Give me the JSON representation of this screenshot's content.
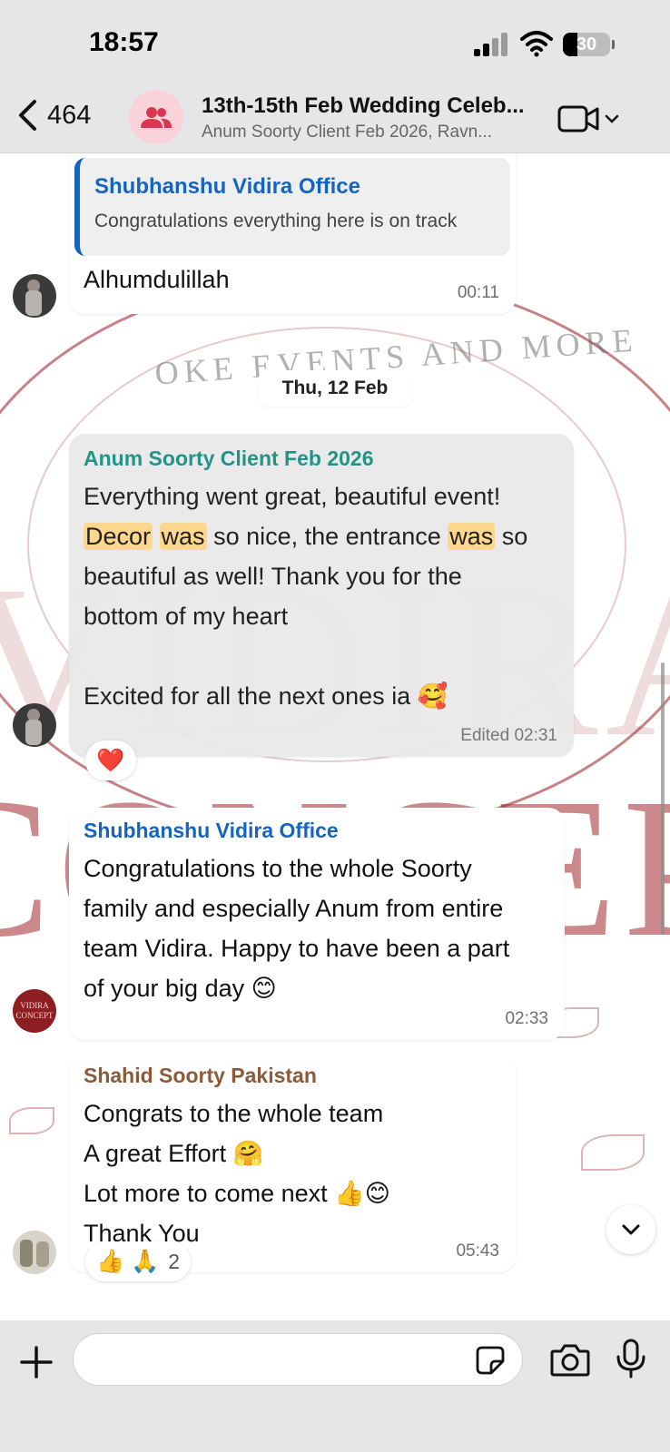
{
  "status_bar": {
    "time": "18:57",
    "battery": "30"
  },
  "header": {
    "back_count": "464",
    "title": "13th-15th Feb Wedding Celeb...",
    "subtitle": "Anum Soorty Client Feb 2026, Ravn..."
  },
  "messages": {
    "m1": {
      "quote_sender": "Shubhanshu Vidira Office",
      "quote_text": "Congratulations everything here is on track",
      "text": "Alhumdulillah",
      "time": "00:11"
    },
    "date_divider": "Thu, 12 Feb",
    "m2": {
      "sender": "Anum Soorty Client Feb 2026",
      "w_decor": "Decor",
      "w_was1": "was",
      "mid1": " so nice, the entrance ",
      "w_was2": "was",
      "tail1": " so",
      "line1": "Everything went great, beautiful event!",
      "line3": "beautiful as well! Thank you for the",
      "line4": "bottom of my heart",
      "line5": "Excited for all the next ones ia 🥰",
      "meta": "Edited 02:31",
      "reaction": "❤️"
    },
    "m3": {
      "sender": "Shubhanshu Vidira Office",
      "line1": "Congratulations to the whole Soorty",
      "line2": "family and especially Anum from entire",
      "line3": "team Vidira. Happy to have been a part",
      "line4": "of your big day 😊",
      "time": "02:33"
    },
    "m4": {
      "sender": "Shahid Soorty Pakistan",
      "line1": "Congrats to the whole team",
      "line2": "A great Effort 🤗",
      "line3": "Lot more to come next 👍😊",
      "line4": "Thank You",
      "time": "05:43",
      "reaction_emojis": "👍 🙏",
      "reaction_count": "2"
    }
  },
  "wallpaper": {
    "brand_text": "VIDIRA CONCEPT"
  },
  "colors": {
    "accent_blue": "#1565c0",
    "sender_teal": "#128c7e",
    "sender_brown": "#8a5a3b",
    "highlight": "#fdd486",
    "bubble_grey": "#e9e9ea"
  }
}
